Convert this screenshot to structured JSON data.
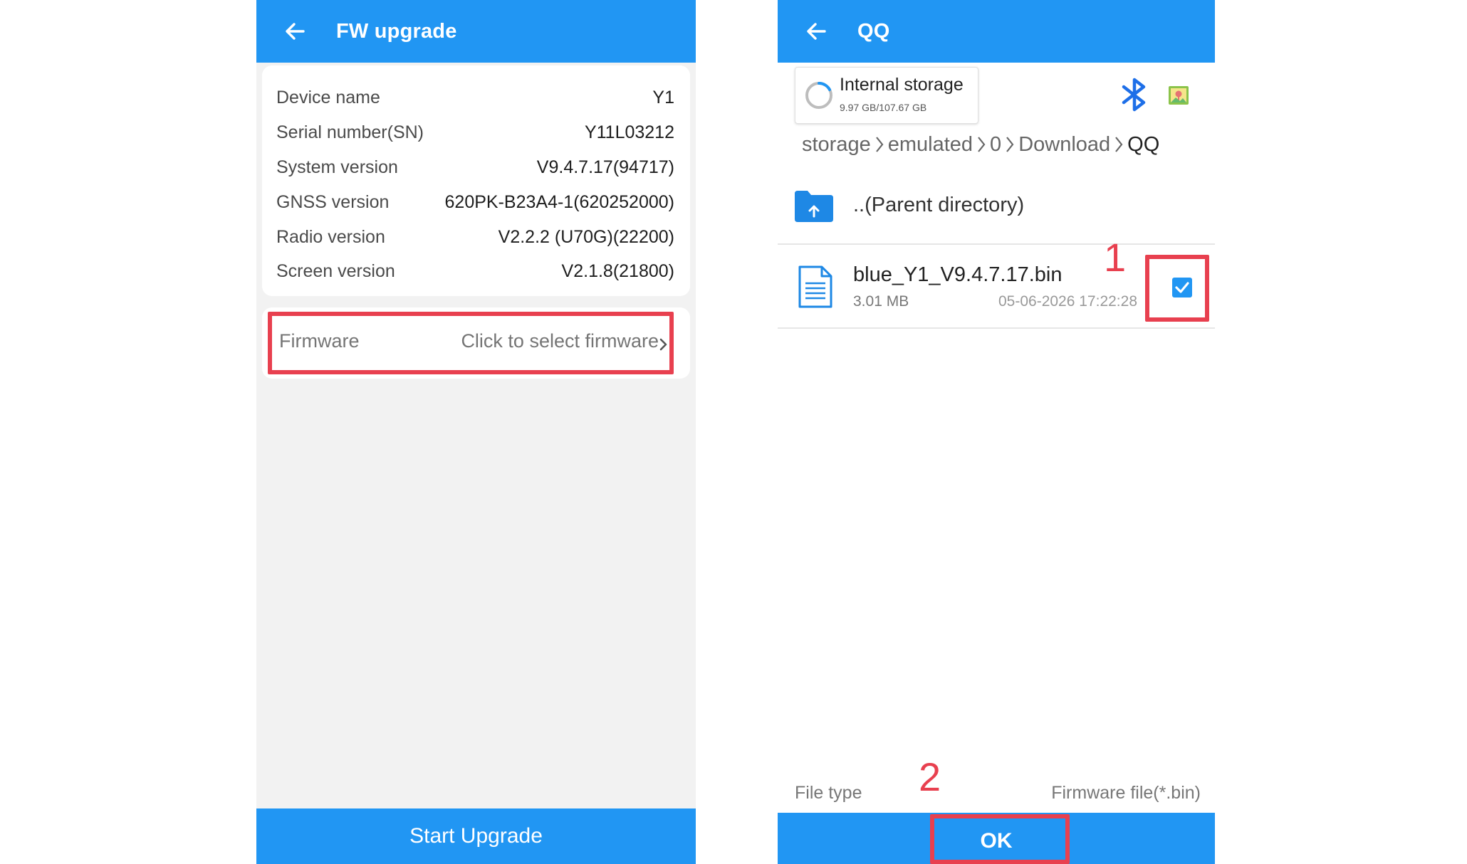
{
  "left_screen": {
    "title": "FW upgrade",
    "info_rows": [
      {
        "label": "Device name",
        "value": "Y1"
      },
      {
        "label": "Serial number(SN)",
        "value": "Y11L03212"
      },
      {
        "label": "System version",
        "value": "V9.4.7.17(94717)"
      },
      {
        "label": "GNSS version",
        "value": "620PK-B23A4-1(620252000)"
      },
      {
        "label": "Radio version",
        "value": "V2.2.2 (U70G)(22200)"
      },
      {
        "label": "Screen version",
        "value": "V2.1.8(21800)"
      }
    ],
    "firmware_label": "Firmware",
    "firmware_value": "Click to select firmware",
    "start_button": "Start Upgrade"
  },
  "right_screen": {
    "title": "QQ",
    "storage": {
      "name": "Internal storage",
      "size": "9.97 GB/107.67 GB"
    },
    "breadcrumb": [
      "storage",
      "emulated",
      "0",
      "Download",
      "QQ"
    ],
    "parent_directory": "..(Parent directory)",
    "file": {
      "name": "blue_Y1_V9.4.7.17.bin",
      "size": "3.01 MB",
      "date": "05-06-2026 17:22:28",
      "checked": true
    },
    "file_type_label": "File type",
    "file_type_value": "Firmware file(*.bin)",
    "ok_button": "OK"
  },
  "annotations": {
    "step1": "1",
    "step2": "2"
  },
  "colors": {
    "primary": "#2196f3",
    "highlight": "#e8404f",
    "background": "#f2f2f2"
  },
  "icons": [
    "back-arrow-icon",
    "chevron-right-icon",
    "storage-spinner-icon",
    "bluetooth-icon",
    "image-icon",
    "folder-up-icon",
    "document-icon",
    "checkmark-icon"
  ]
}
